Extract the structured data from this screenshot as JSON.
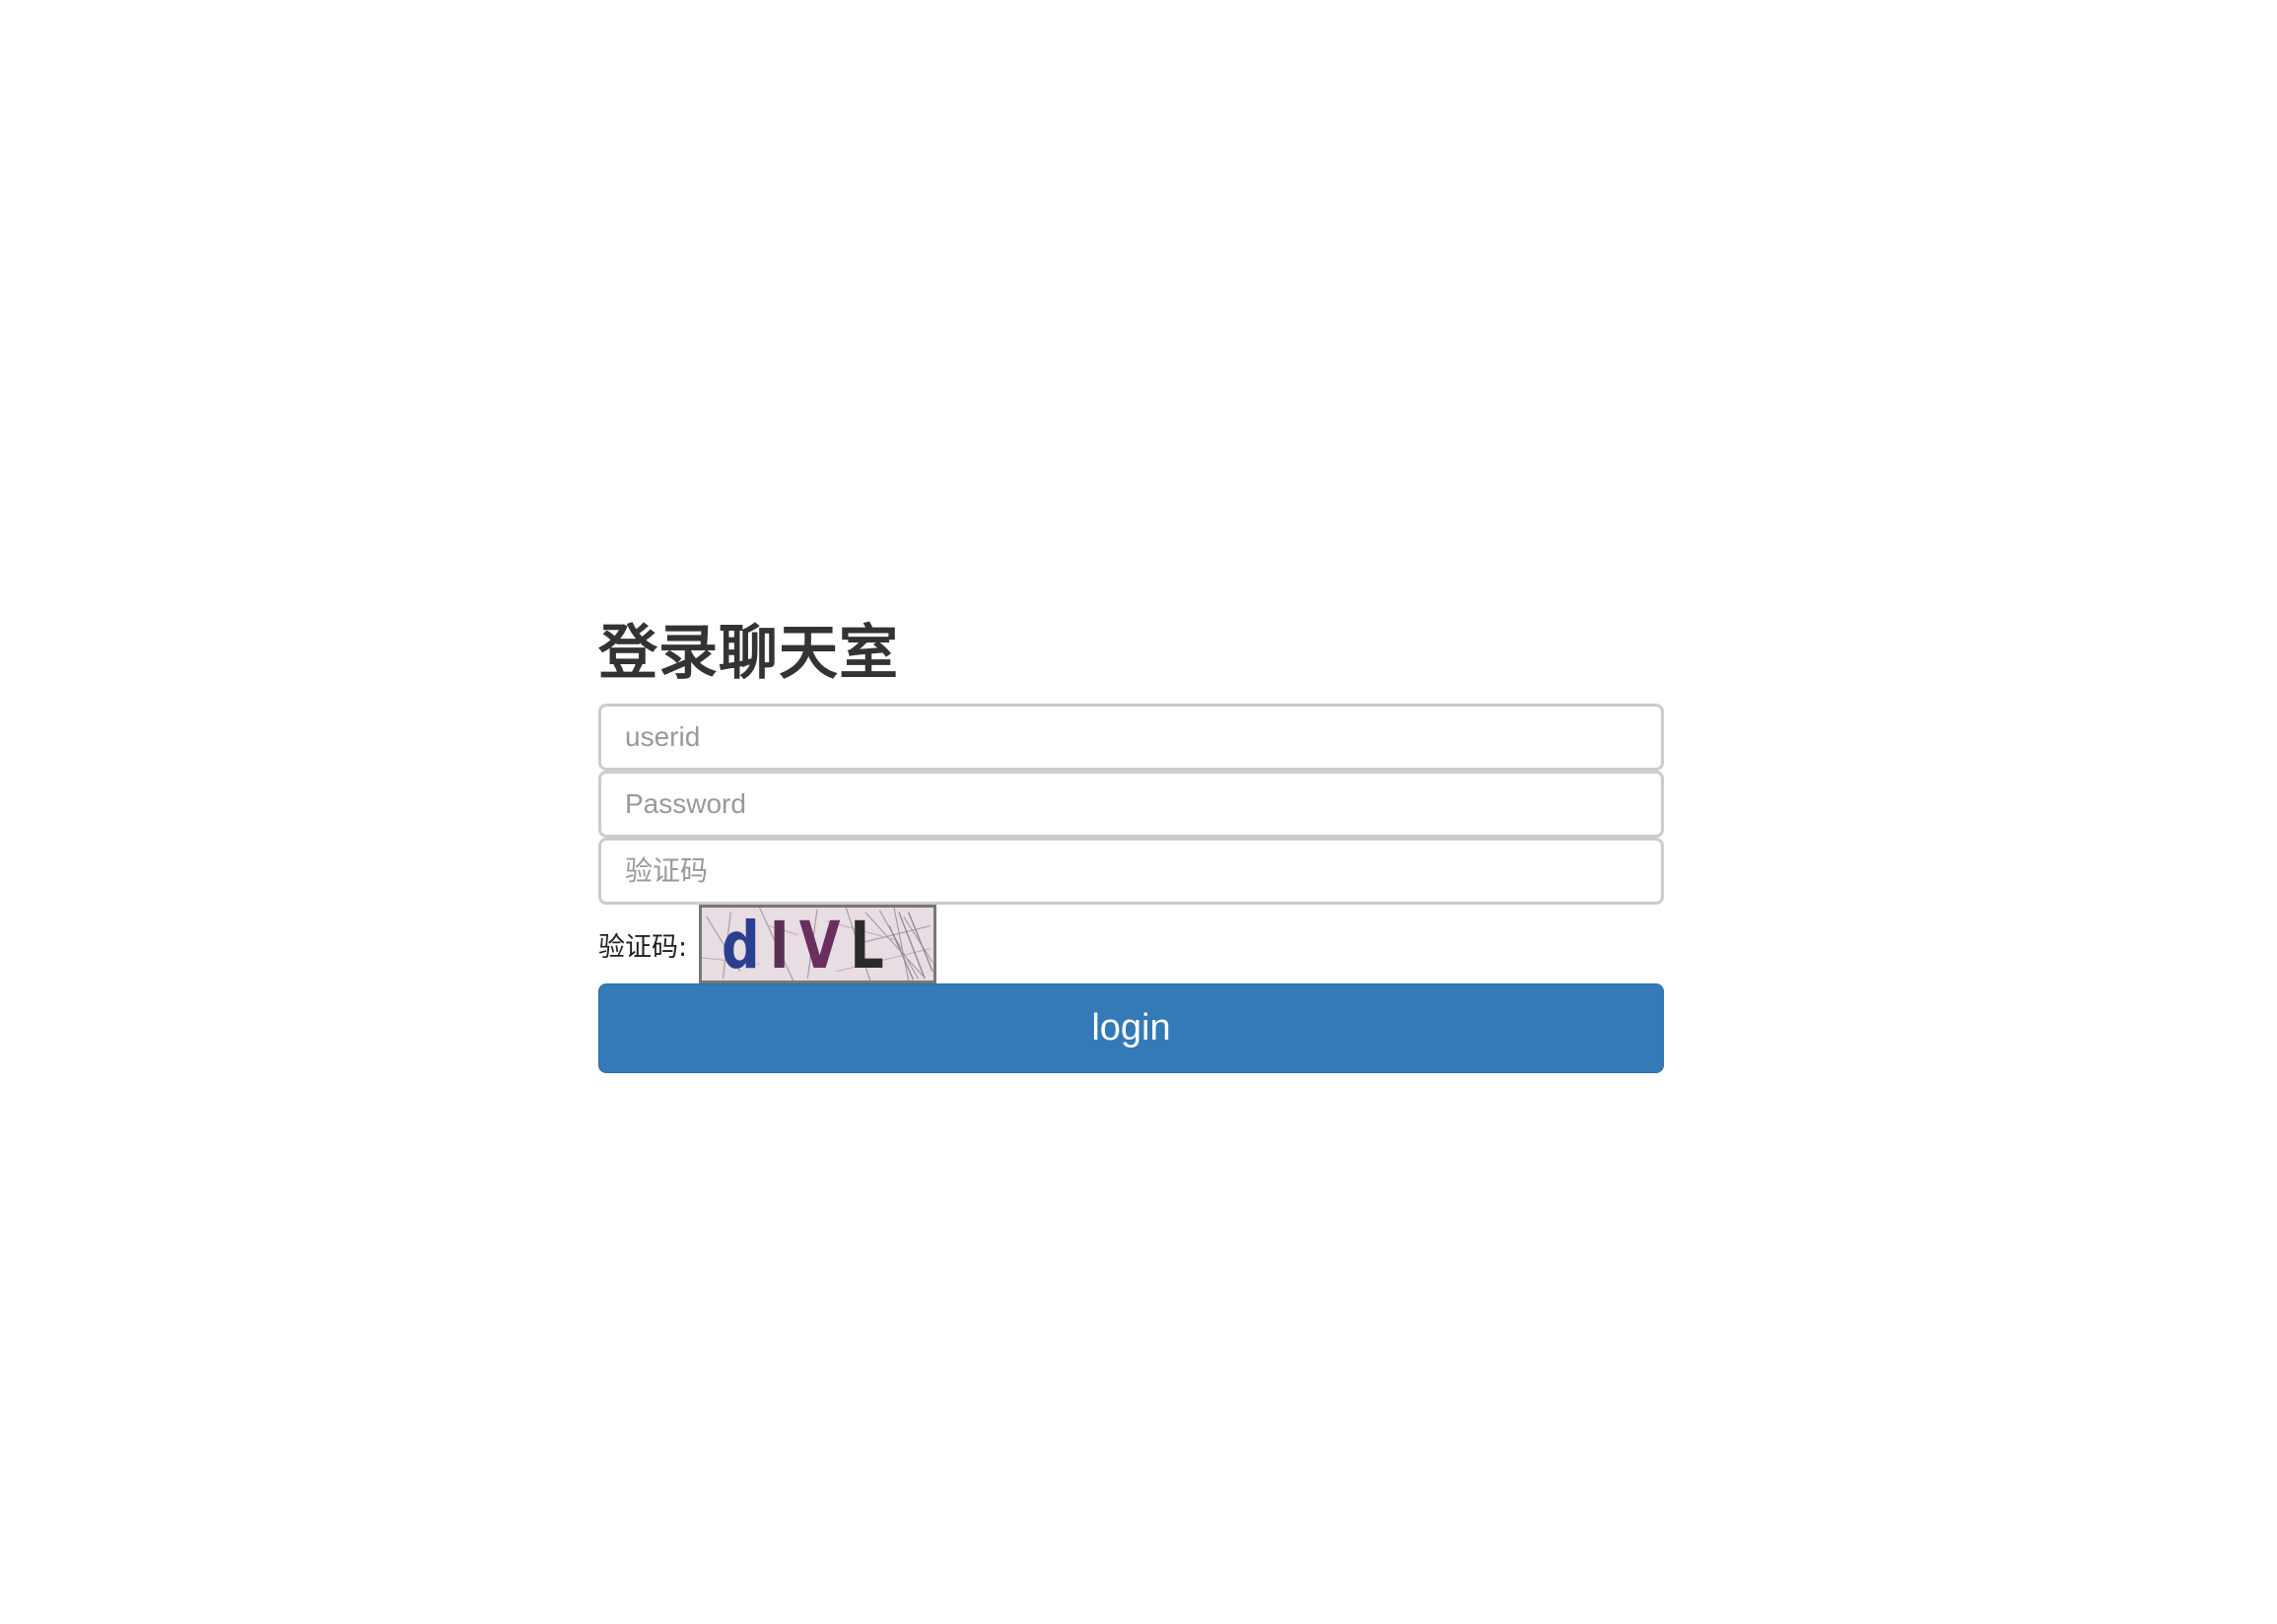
{
  "form": {
    "title": "登录聊天室",
    "userid": {
      "value": "",
      "placeholder": "userid"
    },
    "password": {
      "value": "",
      "placeholder": "Password"
    },
    "captcha_input": {
      "value": "",
      "placeholder": "验证码"
    },
    "captcha_label": "验证码:",
    "captcha_image_text": [
      "d",
      "I",
      "V",
      "L"
    ],
    "login_label": "login"
  },
  "colors": {
    "button": "#337ab7",
    "input_border": "#cccccc",
    "title": "#333333"
  }
}
